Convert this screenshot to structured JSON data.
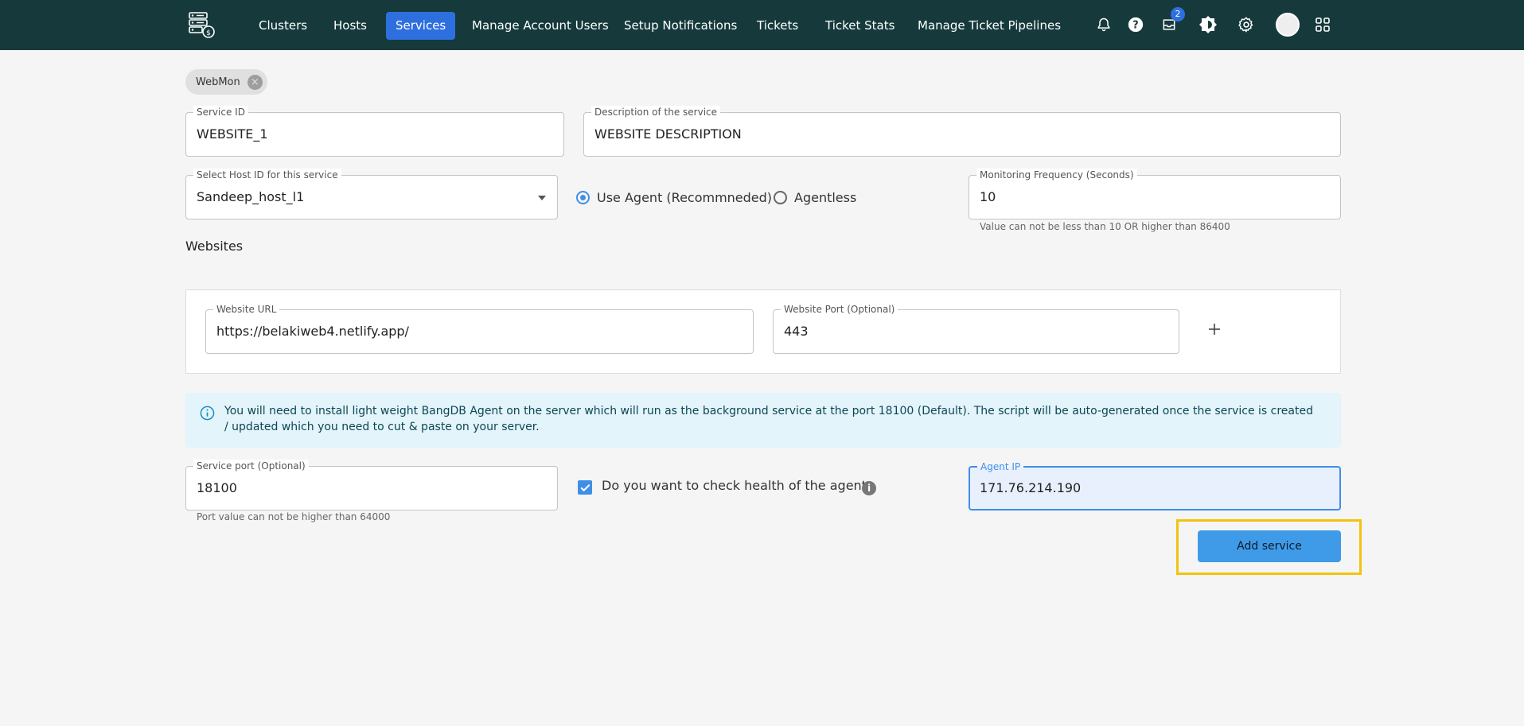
{
  "nav": {
    "items": [
      {
        "label": "Clusters",
        "active": false
      },
      {
        "label": "Hosts",
        "active": false
      },
      {
        "label": "Services",
        "active": true
      },
      {
        "label": "Manage Account Users",
        "active": false
      },
      {
        "label": "Setup Notifications",
        "active": false
      },
      {
        "label": "Tickets",
        "active": false
      },
      {
        "label": "Ticket Stats",
        "active": false
      },
      {
        "label": "Manage Ticket Pipelines",
        "active": false
      }
    ],
    "icons": [
      "bell-icon",
      "help-icon",
      "inbox-icon",
      "brightness-icon",
      "gear-icon",
      "avatar",
      "apps-grid-icon"
    ],
    "inbox_badge": "2"
  },
  "chip": {
    "label": "WebMon"
  },
  "form": {
    "service_id": {
      "label": "Service ID",
      "value": "WEBSITE_1"
    },
    "description": {
      "label": "Description of the service",
      "value": "WEBSITE DESCRIPTION"
    },
    "host": {
      "label": "Select Host ID for this service",
      "value": "Sandeep_host_l1"
    },
    "mode": {
      "options": [
        {
          "label": "Use Agent (Recommneded)",
          "checked": true
        },
        {
          "label": "Agentless",
          "checked": false
        }
      ]
    },
    "frequency": {
      "label": "Monitoring Frequency (Seconds)",
      "value": "10",
      "helper": "Value can not be less than 10 OR higher than 86400"
    },
    "websites_title": "Websites",
    "website_url": {
      "label": "Website URL",
      "value": "https://belakiweb4.netlify.app/"
    },
    "website_port": {
      "label": "Website Port (Optional)",
      "value": "443"
    },
    "info": "You will need to install light weight BangDB Agent on the server which will run as the background service at the port 18100 (Default). The script will be auto-generated once the service is created / updated which you need to cut & paste on your server.",
    "service_port": {
      "label": "Service port (Optional)",
      "value": "18100",
      "helper": "Port value can not be higher than 64000"
    },
    "health_check": {
      "label": "Do you want to check health of the agent",
      "checked": true
    },
    "agent_ip": {
      "label": "Agent IP",
      "value": "171.76.214.190"
    },
    "submit_label": "Add service"
  },
  "colors": {
    "navbar": "#163a3c",
    "active_tab": "#2e6fe0",
    "primary": "#3f9be8",
    "highlight": "#f2c40f",
    "info_bg": "#e3f4fa"
  }
}
